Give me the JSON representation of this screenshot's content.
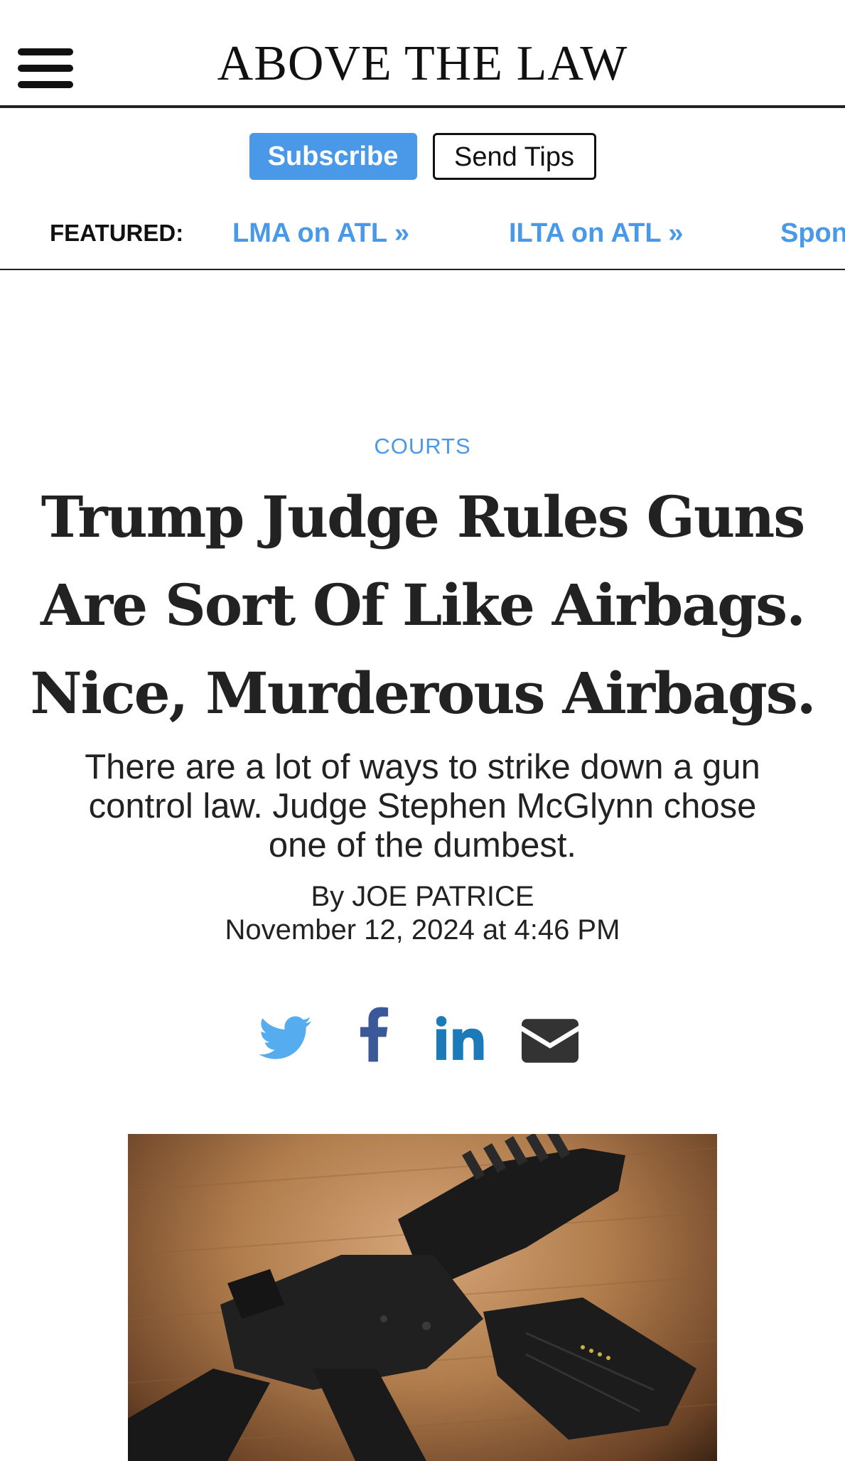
{
  "header": {
    "logo": "ABOVE THE LAW"
  },
  "actions": {
    "subscribe_label": "Subscribe",
    "tips_label": "Send Tips"
  },
  "featured": {
    "label": "FEATURED:",
    "links": [
      "LMA on ATL »",
      "ILTA on ATL »",
      "Spon"
    ]
  },
  "article": {
    "category": "COURTS",
    "headline_lines": [
      "Trump Judge Rules Guns",
      "Are Sort Of Like Airbags.",
      "Nice, Murderous Airbags."
    ],
    "dek_lines": [
      "There are a lot of ways to strike down a gun",
      "control law. Judge Stephen McGlynn chose",
      "one of the dumbest."
    ],
    "byline": "By JOE PATRICE",
    "date": "November 12, 2024 at 4:46 PM"
  },
  "share_icons": [
    "twitter-icon",
    "facebook-icon",
    "linkedin-icon",
    "email-icon"
  ],
  "colors": {
    "accent": "#4a99e9",
    "twitter": "#55acee",
    "facebook": "#3b5998",
    "linkedin": "#1d7ab9",
    "email": "#333333"
  }
}
